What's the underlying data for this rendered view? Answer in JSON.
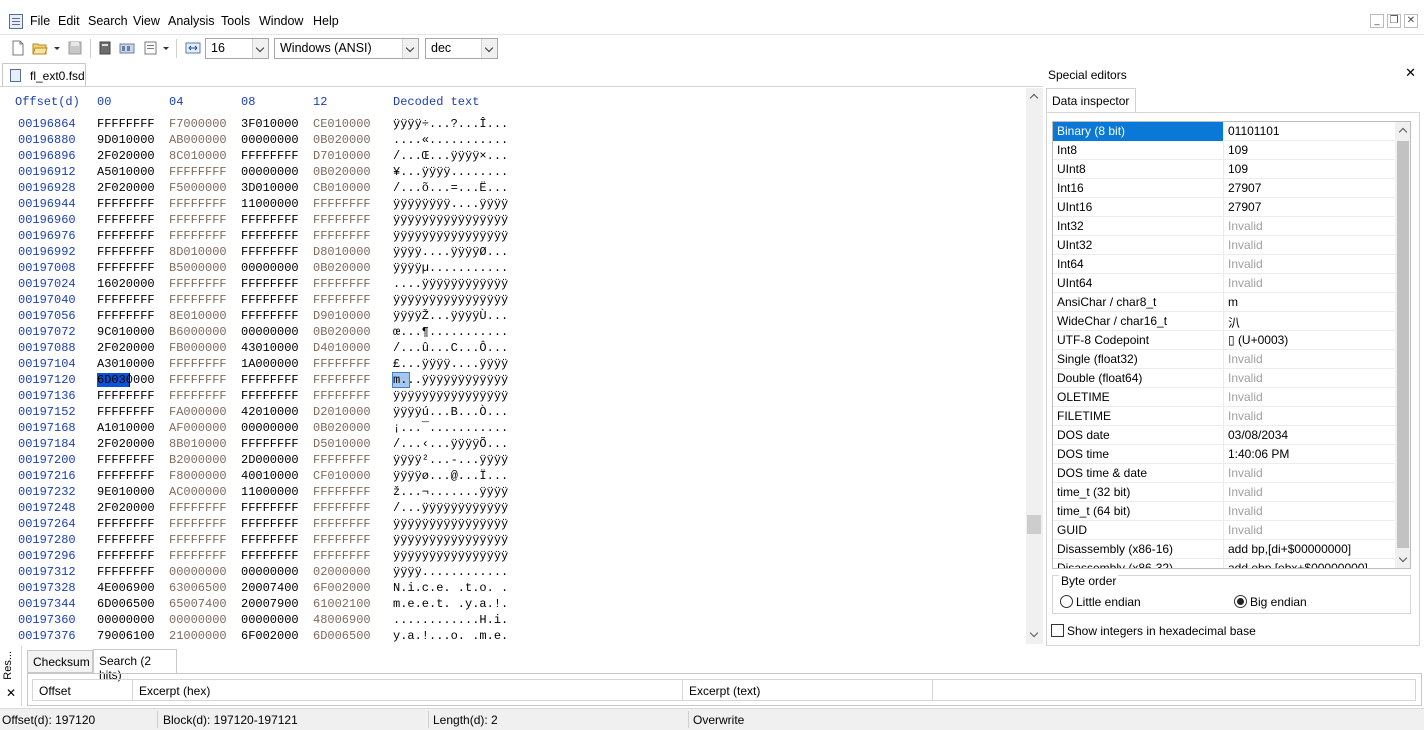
{
  "menu": [
    "File",
    "Edit",
    "Search",
    "View",
    "Analysis",
    "Tools",
    "Window",
    "Help"
  ],
  "toolbar": {
    "bytes_per_row": "16",
    "charset": "Windows (ANSI)",
    "offset_base": "dec"
  },
  "document_tab": "fl_ext0.fsd",
  "hex": {
    "header": {
      "offset": "Offset(d)",
      "cols": [
        "00",
        "04",
        "08",
        "12"
      ],
      "decoded": "Decoded text"
    },
    "rows": [
      {
        "offset": "00196864",
        "groups": [
          "FFFFFFFF",
          "F7000000",
          "3F010000",
          "CE010000"
        ],
        "text": "ÿÿÿÿ÷...?...Î..."
      },
      {
        "offset": "00196880",
        "groups": [
          "9D010000",
          "AB000000",
          "00000000",
          "0B020000"
        ],
        "text": "....«..........."
      },
      {
        "offset": "00196896",
        "groups": [
          "2F020000",
          "8C010000",
          "FFFFFFFF",
          "D7010000"
        ],
        "text": "/...Œ...ÿÿÿÿ×..."
      },
      {
        "offset": "00196912",
        "groups": [
          "A5010000",
          "FFFFFFFF",
          "00000000",
          "0B020000"
        ],
        "text": "¥...ÿÿÿÿ........"
      },
      {
        "offset": "00196928",
        "groups": [
          "2F020000",
          "F5000000",
          "3D010000",
          "CB010000"
        ],
        "text": "/...õ...=...Ë..."
      },
      {
        "offset": "00196944",
        "groups": [
          "FFFFFFFF",
          "FFFFFFFF",
          "11000000",
          "FFFFFFFF"
        ],
        "text": "ÿÿÿÿÿÿÿÿ....ÿÿÿÿ"
      },
      {
        "offset": "00196960",
        "groups": [
          "FFFFFFFF",
          "FFFFFFFF",
          "FFFFFFFF",
          "FFFFFFFF"
        ],
        "text": "ÿÿÿÿÿÿÿÿÿÿÿÿÿÿÿÿ"
      },
      {
        "offset": "00196976",
        "groups": [
          "FFFFFFFF",
          "FFFFFFFF",
          "FFFFFFFF",
          "FFFFFFFF"
        ],
        "text": "ÿÿÿÿÿÿÿÿÿÿÿÿÿÿÿÿ"
      },
      {
        "offset": "00196992",
        "groups": [
          "FFFFFFFF",
          "8D010000",
          "FFFFFFFF",
          "D8010000"
        ],
        "text": "ÿÿÿÿ....ÿÿÿÿØ..."
      },
      {
        "offset": "00197008",
        "groups": [
          "FFFFFFFF",
          "B5000000",
          "00000000",
          "0B020000"
        ],
        "text": "ÿÿÿÿµ..........."
      },
      {
        "offset": "00197024",
        "groups": [
          "16020000",
          "FFFFFFFF",
          "FFFFFFFF",
          "FFFFFFFF"
        ],
        "text": "....ÿÿÿÿÿÿÿÿÿÿÿÿ"
      },
      {
        "offset": "00197040",
        "groups": [
          "FFFFFFFF",
          "FFFFFFFF",
          "FFFFFFFF",
          "FFFFFFFF"
        ],
        "text": "ÿÿÿÿÿÿÿÿÿÿÿÿÿÿÿÿ"
      },
      {
        "offset": "00197056",
        "groups": [
          "FFFFFFFF",
          "8E010000",
          "FFFFFFFF",
          "D9010000"
        ],
        "text": "ÿÿÿÿŽ...ÿÿÿÿÙ..."
      },
      {
        "offset": "00197072",
        "groups": [
          "9C010000",
          "B6000000",
          "00000000",
          "0B020000"
        ],
        "text": "œ...¶..........."
      },
      {
        "offset": "00197088",
        "groups": [
          "2F020000",
          "FB000000",
          "43010000",
          "D4010000"
        ],
        "text": "/...û...C...Ô..."
      },
      {
        "offset": "00197104",
        "groups": [
          "A3010000",
          "FFFFFFFF",
          "1A000000",
          "FFFFFFFF"
        ],
        "text": "£...ÿÿÿÿ....ÿÿÿÿ"
      },
      {
        "offset": "00197120",
        "groups": [
          "6D030000",
          "FFFFFFFF",
          "FFFFFFFF",
          "FFFFFFFF"
        ],
        "text": "m...ÿÿÿÿÿÿÿÿÿÿÿÿ"
      },
      {
        "offset": "00197136",
        "groups": [
          "FFFFFFFF",
          "FFFFFFFF",
          "FFFFFFFF",
          "FFFFFFFF"
        ],
        "text": "ÿÿÿÿÿÿÿÿÿÿÿÿÿÿÿÿ"
      },
      {
        "offset": "00197152",
        "groups": [
          "FFFFFFFF",
          "FA000000",
          "42010000",
          "D2010000"
        ],
        "text": "ÿÿÿÿú...B...Ò..."
      },
      {
        "offset": "00197168",
        "groups": [
          "A1010000",
          "AF000000",
          "00000000",
          "0B020000"
        ],
        "text": "¡...¯..........."
      },
      {
        "offset": "00197184",
        "groups": [
          "2F020000",
          "8B010000",
          "FFFFFFFF",
          "D5010000"
        ],
        "text": "/...‹...ÿÿÿÿÕ..."
      },
      {
        "offset": "00197200",
        "groups": [
          "FFFFFFFF",
          "B2000000",
          "2D000000",
          "FFFFFFFF"
        ],
        "text": "ÿÿÿÿ²...-...ÿÿÿÿ"
      },
      {
        "offset": "00197216",
        "groups": [
          "FFFFFFFF",
          "F8000000",
          "40010000",
          "CF010000"
        ],
        "text": "ÿÿÿÿø...@...Ï..."
      },
      {
        "offset": "00197232",
        "groups": [
          "9E010000",
          "AC000000",
          "11000000",
          "FFFFFFFF"
        ],
        "text": "ž...¬.......ÿÿÿÿ"
      },
      {
        "offset": "00197248",
        "groups": [
          "2F020000",
          "FFFFFFFF",
          "FFFFFFFF",
          "FFFFFFFF"
        ],
        "text": "/...ÿÿÿÿÿÿÿÿÿÿÿÿ"
      },
      {
        "offset": "00197264",
        "groups": [
          "FFFFFFFF",
          "FFFFFFFF",
          "FFFFFFFF",
          "FFFFFFFF"
        ],
        "text": "ÿÿÿÿÿÿÿÿÿÿÿÿÿÿÿÿ"
      },
      {
        "offset": "00197280",
        "groups": [
          "FFFFFFFF",
          "FFFFFFFF",
          "FFFFFFFF",
          "FFFFFFFF"
        ],
        "text": "ÿÿÿÿÿÿÿÿÿÿÿÿÿÿÿÿ"
      },
      {
        "offset": "00197296",
        "groups": [
          "FFFFFFFF",
          "FFFFFFFF",
          "FFFFFFFF",
          "FFFFFFFF"
        ],
        "text": "ÿÿÿÿÿÿÿÿÿÿÿÿÿÿÿÿ"
      },
      {
        "offset": "00197312",
        "groups": [
          "FFFFFFFF",
          "00000000",
          "00000000",
          "02000000"
        ],
        "text": "ÿÿÿÿ............"
      },
      {
        "offset": "00197328",
        "groups": [
          "4E006900",
          "63006500",
          "20007400",
          "6F002000"
        ],
        "text": "N.i.c.e. .t.o. ."
      },
      {
        "offset": "00197344",
        "groups": [
          "6D006500",
          "65007400",
          "20007900",
          "61002100"
        ],
        "text": "m.e.e.t. .y.a.!."
      },
      {
        "offset": "00197360",
        "groups": [
          "00000000",
          "00000000",
          "00000000",
          "48006900"
        ],
        "text": "............H.i."
      },
      {
        "offset": "00197376",
        "groups": [
          "79006100",
          "21000000",
          "6F002000",
          "6D006500"
        ],
        "text": "y.a.!...o. .m.e."
      }
    ]
  },
  "special_editors": {
    "title": "Special editors",
    "tab": "Data inspector",
    "rows": [
      {
        "k": "Binary (8 bit)",
        "v": "01101101",
        "invalid": false,
        "selected": true
      },
      {
        "k": "Int8",
        "v": "109",
        "invalid": false
      },
      {
        "k": "UInt8",
        "v": "109",
        "invalid": false
      },
      {
        "k": "Int16",
        "v": "27907",
        "invalid": false
      },
      {
        "k": "UInt16",
        "v": "27907",
        "invalid": false
      },
      {
        "k": "Int32",
        "v": "Invalid",
        "invalid": true
      },
      {
        "k": "UInt32",
        "v": "Invalid",
        "invalid": true
      },
      {
        "k": "Int64",
        "v": "Invalid",
        "invalid": true
      },
      {
        "k": "UInt64",
        "v": "Invalid",
        "invalid": true
      },
      {
        "k": "AnsiChar / char8_t",
        "v": "m",
        "invalid": false
      },
      {
        "k": "WideChar / char16_t",
        "v": "汃",
        "invalid": false
      },
      {
        "k": "UTF-8 Codepoint",
        "v": "▯ (U+0003)",
        "invalid": false
      },
      {
        "k": "Single (float32)",
        "v": "Invalid",
        "invalid": true
      },
      {
        "k": "Double (float64)",
        "v": "Invalid",
        "invalid": true
      },
      {
        "k": "OLETIME",
        "v": "Invalid",
        "invalid": true
      },
      {
        "k": "FILETIME",
        "v": "Invalid",
        "invalid": true
      },
      {
        "k": "DOS date",
        "v": "03/08/2034",
        "invalid": false
      },
      {
        "k": "DOS time",
        "v": "1:40:06 PM",
        "invalid": false
      },
      {
        "k": "DOS time & date",
        "v": "Invalid",
        "invalid": true
      },
      {
        "k": "time_t (32 bit)",
        "v": "Invalid",
        "invalid": true
      },
      {
        "k": "time_t (64 bit)",
        "v": "Invalid",
        "invalid": true
      },
      {
        "k": "GUID",
        "v": "Invalid",
        "invalid": true
      },
      {
        "k": "Disassembly (x86-16)",
        "v": "add bp,[di+$00000000]",
        "invalid": false
      },
      {
        "k": "Disassembly (x86-32)",
        "v": "add ebp,[ebx+$00000000]",
        "invalid": false
      }
    ],
    "byte_order": {
      "legend": "Byte order",
      "little": "Little endian",
      "big": "Big endian",
      "selected": "big"
    },
    "hex_checkbox": "Show integers in hexadecimal base"
  },
  "bottom": {
    "side_label": "Res...",
    "tabs": [
      "Checksum",
      "Search (2 hits)"
    ],
    "columns": [
      "Offset",
      "Excerpt (hex)",
      "Excerpt (text)"
    ]
  },
  "status": {
    "offset": "Offset(d): 197120",
    "block": "Block(d): 197120-197121",
    "length": "Length(d): 2",
    "mode": "Overwrite"
  }
}
